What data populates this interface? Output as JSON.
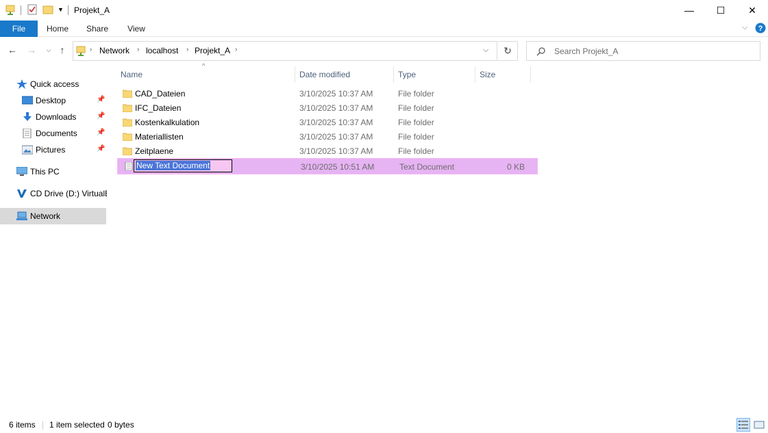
{
  "window": {
    "title": "Projekt_A",
    "minimize": "—",
    "maximize": "☐",
    "close": "✕"
  },
  "ribbon": {
    "tabs": [
      "File",
      "Home",
      "Share",
      "View"
    ]
  },
  "address": {
    "crumbs": [
      "Network",
      "localhost",
      "Projekt_A"
    ],
    "search_placeholder": "Search Projekt_A"
  },
  "nav": {
    "quick_access": "Quick access",
    "items": [
      {
        "label": "Desktop",
        "icon": "desktop-icon",
        "pinned": true
      },
      {
        "label": "Downloads",
        "icon": "downloads-icon",
        "pinned": true
      },
      {
        "label": "Documents",
        "icon": "documents-icon",
        "pinned": true
      },
      {
        "label": "Pictures",
        "icon": "pictures-icon",
        "pinned": true
      }
    ],
    "this_pc": "This PC",
    "cd_drive": "CD Drive (D:) VirtualB",
    "network": "Network"
  },
  "columns": {
    "name": "Name",
    "date": "Date modified",
    "type": "Type",
    "size": "Size"
  },
  "files": [
    {
      "name": "CAD_Dateien",
      "date": "3/10/2025 10:37 AM",
      "type": "File folder",
      "size": ""
    },
    {
      "name": "IFC_Dateien",
      "date": "3/10/2025 10:37 AM",
      "type": "File folder",
      "size": ""
    },
    {
      "name": "Kostenkalkulation",
      "date": "3/10/2025 10:37 AM",
      "type": "File folder",
      "size": ""
    },
    {
      "name": "Materiallisten",
      "date": "3/10/2025 10:37 AM",
      "type": "File folder",
      "size": ""
    },
    {
      "name": "Zeitplaene",
      "date": "3/10/2025 10:37 AM",
      "type": "File folder",
      "size": ""
    },
    {
      "name": "New Text Document",
      "date": "3/10/2025 10:51 AM",
      "type": "Text Document",
      "size": "0 KB"
    }
  ],
  "status": {
    "items": "6 items",
    "selected": "1 item selected",
    "bytes": "0 bytes"
  },
  "colors": {
    "accent": "#1979ca",
    "selection": "#e6b3f3",
    "folder": "#f8d775",
    "nav_selected": "#cce8ff"
  }
}
